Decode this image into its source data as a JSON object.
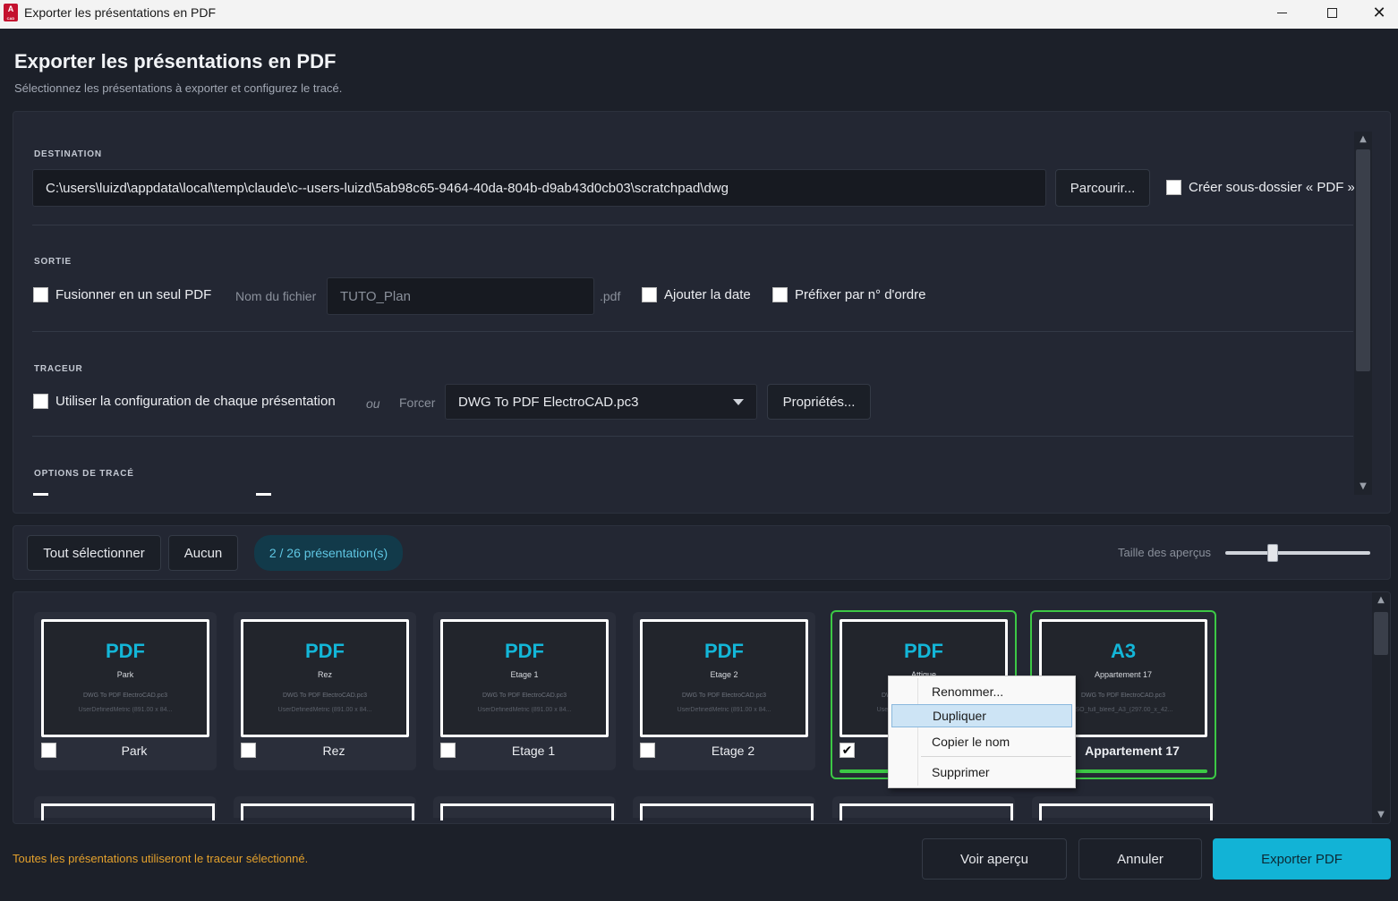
{
  "window": {
    "title": "Exporter les présentations en PDF",
    "app_icon_letter": "A"
  },
  "header": {
    "title": "Exporter les présentations en PDF",
    "subtitle": "Sélectionnez les présentations à exporter et configurez le tracé."
  },
  "destination": {
    "label": "DESTINATION",
    "path": "C:\\users\\luizd\\appdata\\local\\temp\\claude\\c--users-luizd\\5ab98c65-9464-40da-804b-d9ab43d0cb03\\scratchpad\\dwg",
    "browse_label": "Parcourir...",
    "subfolder_label": "Créer sous-dossier « PDF »",
    "subfolder_checked": false
  },
  "output": {
    "label": "SORTIE",
    "merge_label": "Fusionner en un seul PDF",
    "filename_label": "Nom du fichier",
    "filename_placeholder": "TUTO_Plan",
    "ext": ".pdf",
    "add_date_label": "Ajouter la date",
    "prefix_label": "Préfixer par n° d'ordre"
  },
  "plotter": {
    "label": "TRACEUR",
    "use_layout_config_label": "Utiliser la configuration de chaque présentation",
    "or_label": "ou",
    "force_label": "Forcer",
    "selected": "DWG To PDF ElectroCAD.pc3",
    "properties_label": "Propriétés..."
  },
  "plot_options": {
    "label": "OPTIONS DE TRACÉ"
  },
  "toolbar": {
    "select_all": "Tout sélectionner",
    "none": "Aucun",
    "count": "2 / 26 présentation(s)",
    "preview_size_label": "Taille des aperçus",
    "preview_size": 0.33
  },
  "layouts": [
    {
      "big": "PDF",
      "name": "Park",
      "plotter": "DWG To PDF ElectroCAD.pc3",
      "paper": "UserDefinedMetric (891.00 x 84...",
      "label": "Park",
      "checked": false
    },
    {
      "big": "PDF",
      "name": "Rez",
      "plotter": "DWG To PDF ElectroCAD.pc3",
      "paper": "UserDefinedMetric (891.00 x 84...",
      "label": "Rez",
      "checked": false
    },
    {
      "big": "PDF",
      "name": "Etage 1",
      "plotter": "DWG To PDF ElectroCAD.pc3",
      "paper": "UserDefinedMetric (891.00 x 84...",
      "label": "Etage 1",
      "checked": false
    },
    {
      "big": "PDF",
      "name": "Etage 2",
      "plotter": "DWG To PDF ElectroCAD.pc3",
      "paper": "UserDefinedMetric (891.00 x 84...",
      "label": "Etage 2",
      "checked": false
    },
    {
      "big": "PDF",
      "name": "Attique",
      "plotter": "DWG To PDF ElectroCAD.pc3",
      "paper": "UserDefinedMetric (891.00 x 84...",
      "label": "Attique",
      "checked": true
    },
    {
      "big": "A3",
      "name": "Appartement 17",
      "plotter": "DWG To PDF ElectroCAD.pc3",
      "paper": "ISO_full_bleed_A3_(297.00_x_42...",
      "label": "Appartement 17",
      "checked": true
    }
  ],
  "context_menu": {
    "items": [
      "Renommer...",
      "Dupliquer",
      "Copier le nom",
      "Supprimer"
    ],
    "highlighted": "Dupliquer"
  },
  "footer": {
    "note": "Toutes les présentations utiliseront le traceur sélectionné.",
    "preview_label": "Voir aperçu",
    "cancel_label": "Annuler",
    "export_label": "Exporter PDF"
  },
  "colors": {
    "accent": "#12b3d6",
    "selected_border": "#3cc845",
    "warning": "#e4a12c"
  }
}
